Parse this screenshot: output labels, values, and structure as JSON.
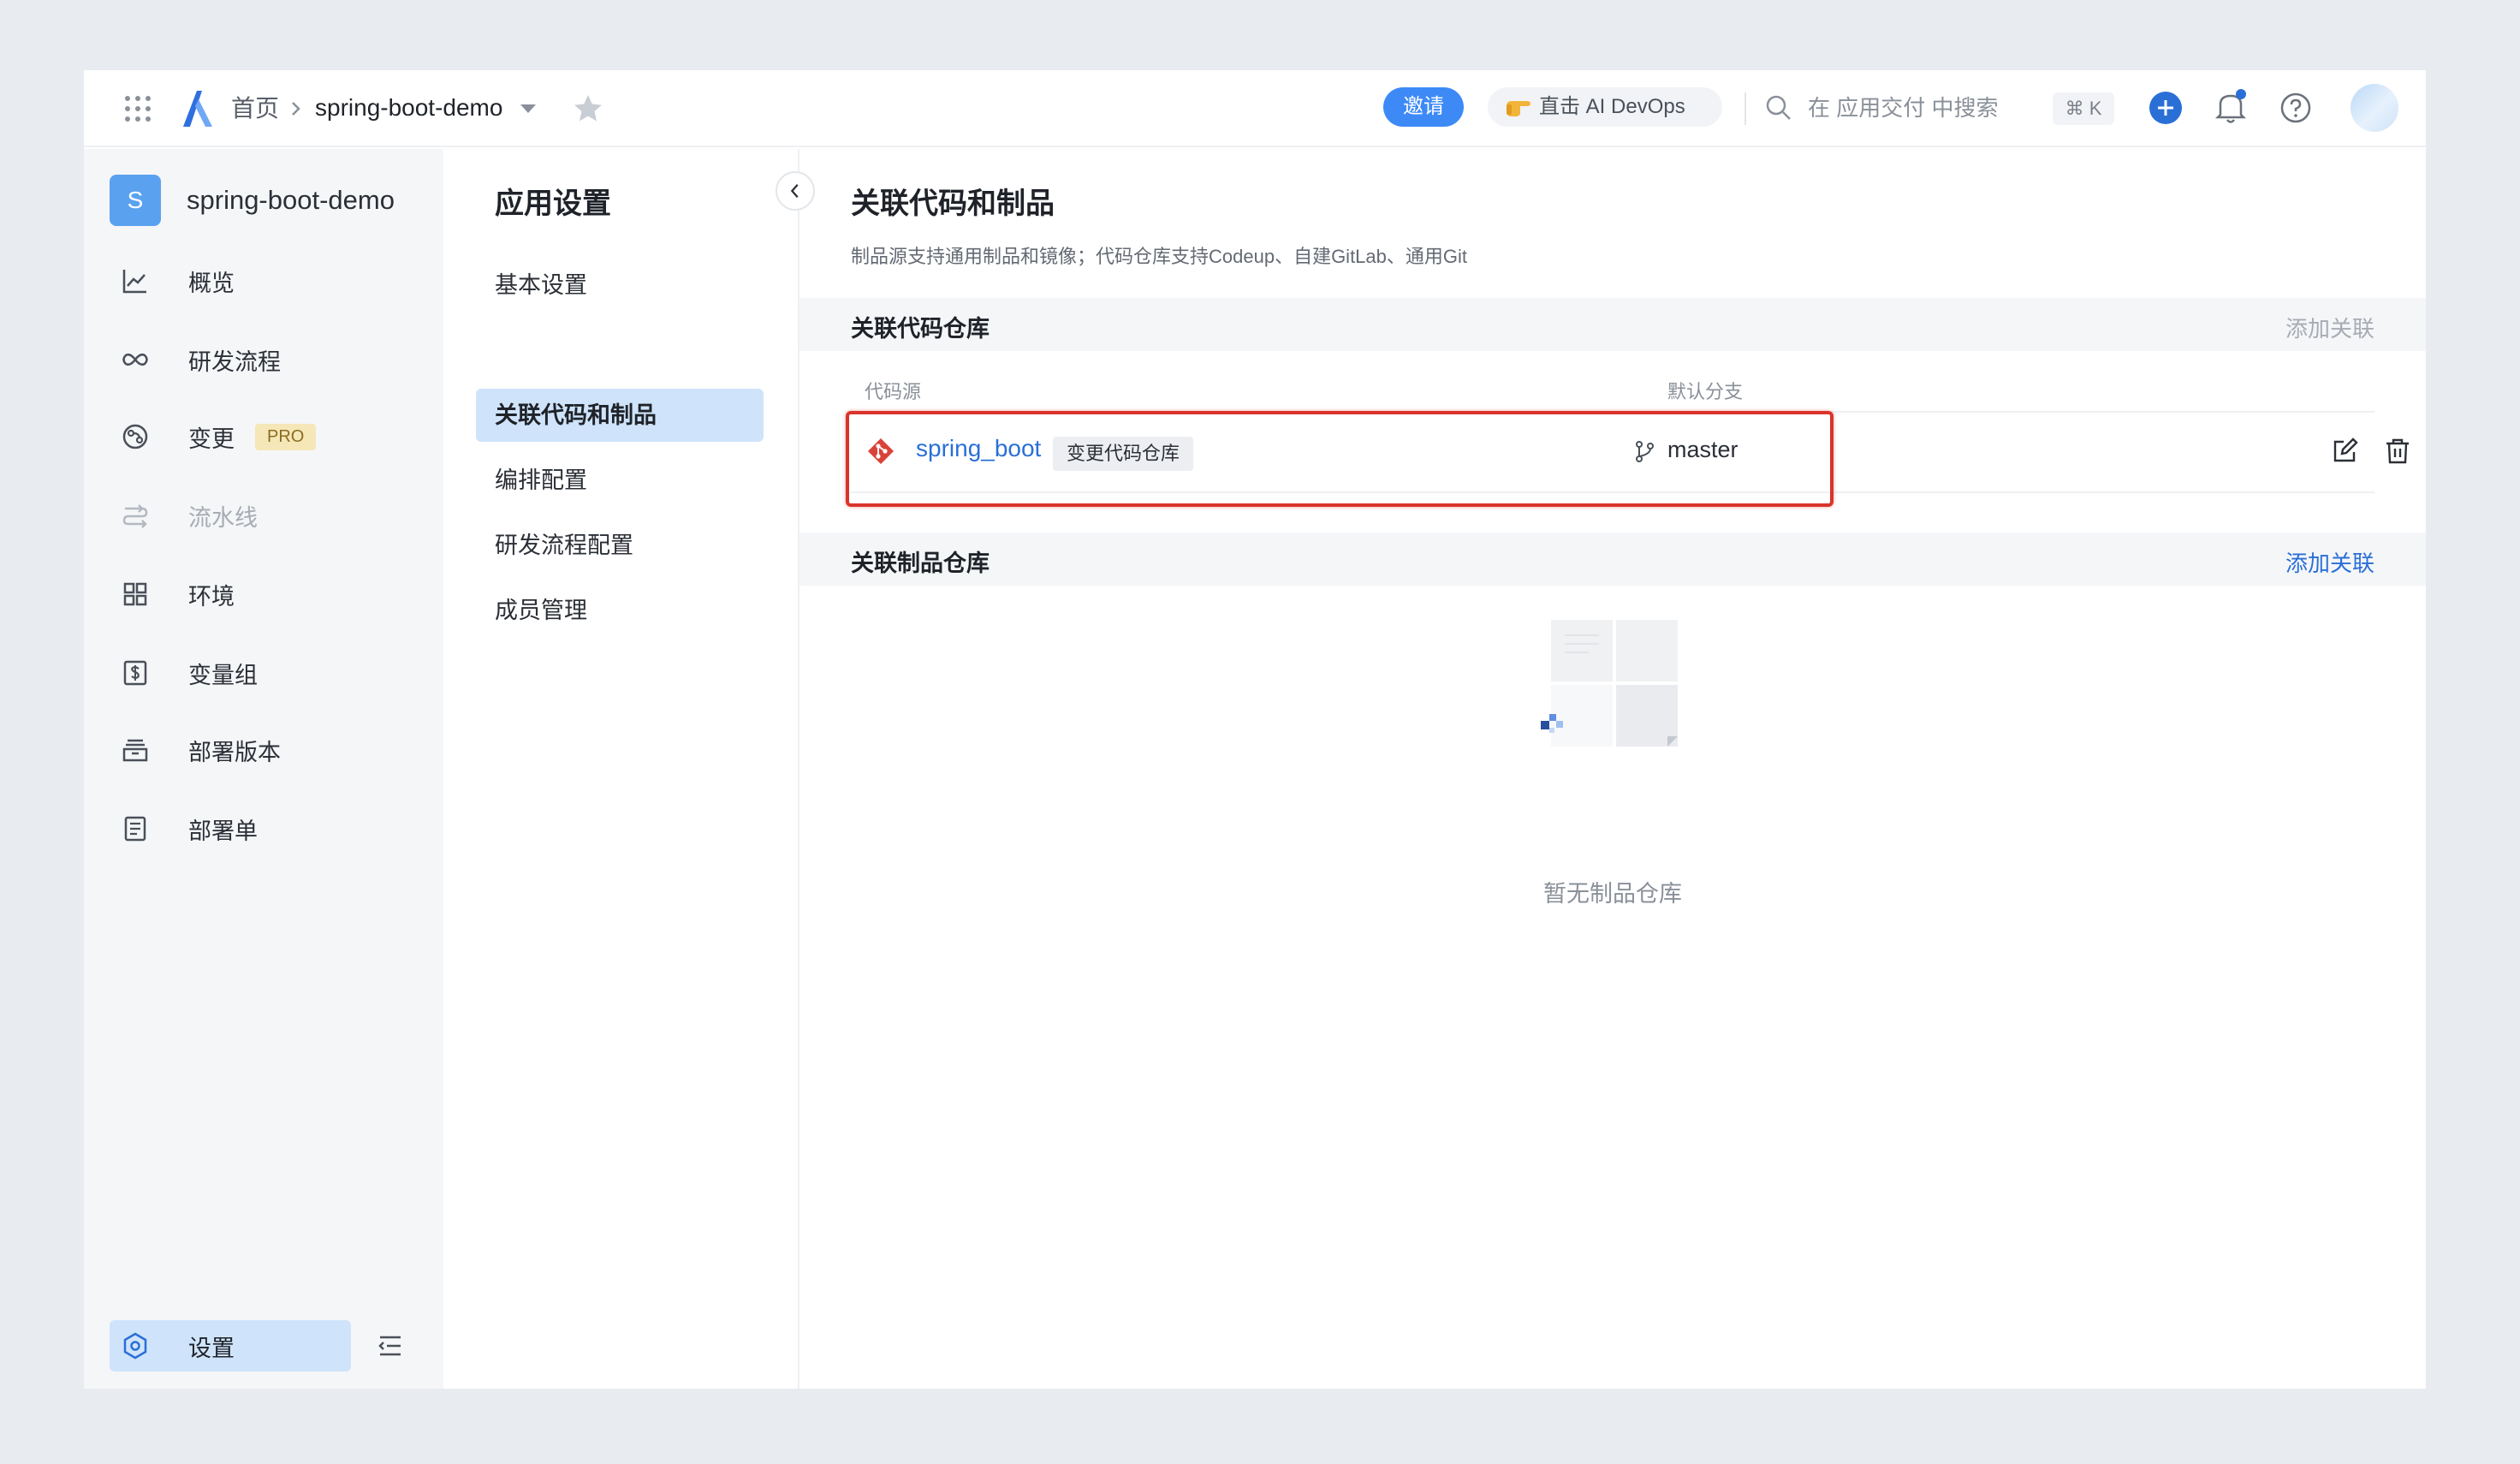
{
  "topbar": {
    "apps_icon": "grid-apps-icon",
    "breadcrumb_home": "首页",
    "breadcrumb_app": "spring-boot-demo",
    "invite_label": "邀请",
    "devops_label": "直击 AI DevOps",
    "search_placeholder": "在 应用交付 中搜索",
    "shortcut": "⌘ K",
    "accent_color": "#3d8af7"
  },
  "leftnav": {
    "app_badge": "S",
    "app_name": "spring-boot-demo",
    "items": [
      {
        "label": "概览",
        "icon": "chart-line-icon"
      },
      {
        "label": "研发流程",
        "icon": "infinity-icon"
      },
      {
        "label": "变更",
        "icon": "change-icon",
        "badge": "PRO"
      },
      {
        "label": "流水线",
        "icon": "pipeline-icon"
      },
      {
        "label": "环境",
        "icon": "grid-icon"
      },
      {
        "label": "变量组",
        "icon": "dollar-icon"
      },
      {
        "label": "部署版本",
        "icon": "archive-icon"
      },
      {
        "label": "部署单",
        "icon": "document-icon"
      }
    ],
    "settings_label": "设置"
  },
  "settings_menu": {
    "title": "应用设置",
    "items": [
      "基本设置",
      "关联代码和制品",
      "编排配置",
      "研发流程配置",
      "成员管理"
    ]
  },
  "main": {
    "title": "关联代码和制品",
    "description": "制品源支持通用制品和镜像；代码仓库支持Codeup、自建GitLab、通用Git",
    "code_section": {
      "title": "关联代码仓库",
      "add_link": "添加关联",
      "col_source": "代码源",
      "col_branch": "默认分支",
      "repo_name": "spring_boot",
      "repo_tag": "变更代码仓库",
      "branch": "master"
    },
    "artifact_section": {
      "title": "关联制品仓库",
      "add_link": "添加关联",
      "empty_text": "暂无制品仓库"
    }
  },
  "highlight_color": "#d9342b"
}
